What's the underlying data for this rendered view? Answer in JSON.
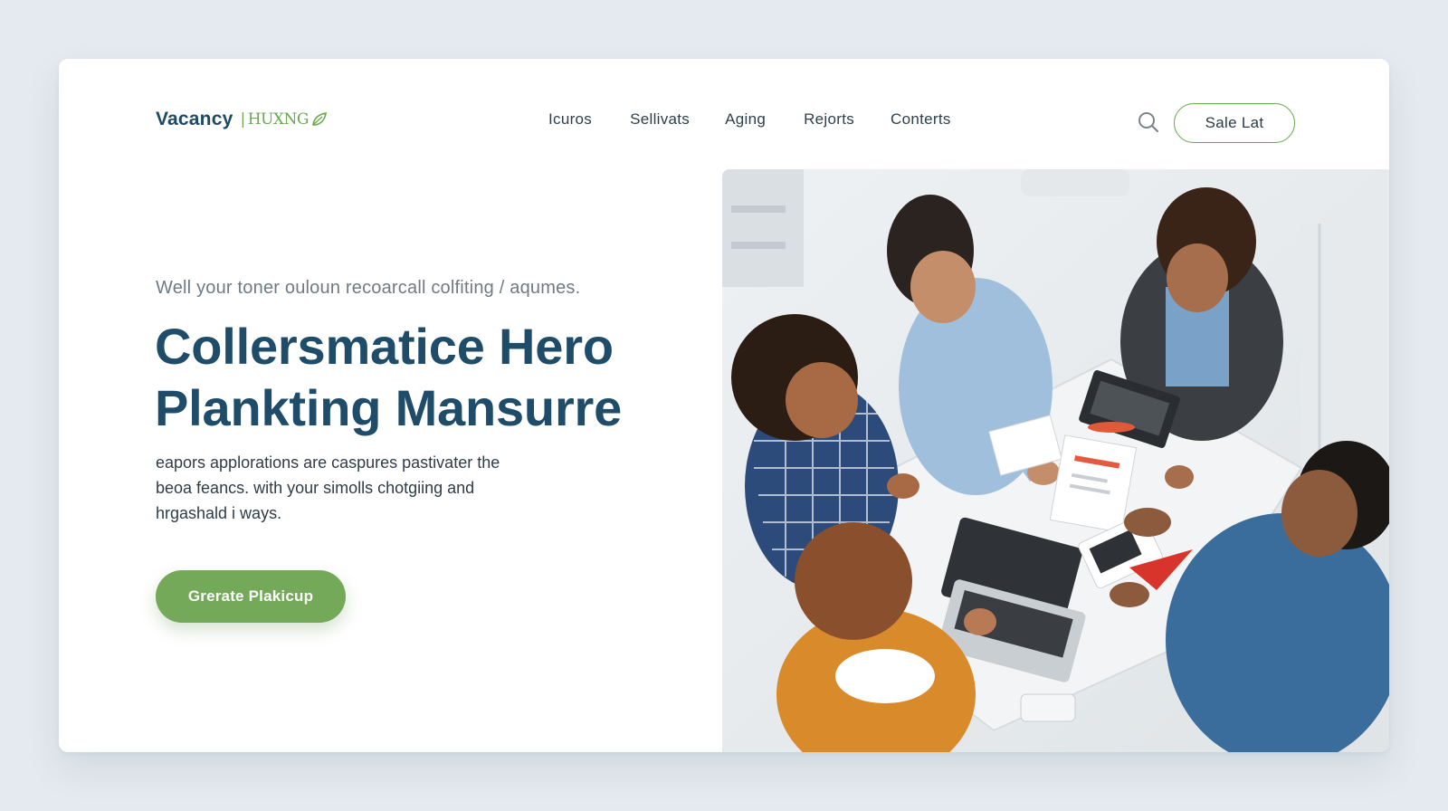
{
  "brand": {
    "name": "Vacancy",
    "mark": "HUXNG",
    "accent": "#6aa84f",
    "primary": "#1f4c69"
  },
  "nav": {
    "items": [
      "Icuros",
      "Sellivats",
      "Aging",
      "Rejorts",
      "Conterts"
    ],
    "search_icon": "search-icon",
    "action_label": "Sale Lat"
  },
  "hero": {
    "eyebrow": "Well your toner ouloun recoarcall colfiting / aqumes.",
    "headline_lines": [
      "Collersmatice Hero",
      "Plankting Mansurre"
    ],
    "body_lines": [
      "eapors applorations are caspures pastivater the",
      "beoa feancs. with your simolls chotgiing and",
      "hrgashald i ways."
    ],
    "cta_label": "Grerate Plakicup",
    "cta_color": "#73a958",
    "image_subject": "team of five people collaborating around a table with laptops and documents, top-down view"
  }
}
